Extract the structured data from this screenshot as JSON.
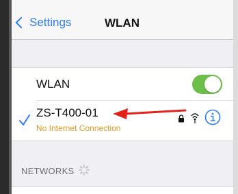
{
  "nav": {
    "back_label": "Settings",
    "title": "WLAN"
  },
  "wlan_row": {
    "label": "WLAN",
    "toggle_on": true
  },
  "connected_network": {
    "ssid": "ZS-T400-01",
    "status": "No Internet Connection",
    "icons": [
      "checkmark-icon",
      "lock-icon",
      "wifi-icon",
      "info-icon"
    ]
  },
  "networks_section": {
    "header": "NETWORKS"
  },
  "colors": {
    "accent": "#2e7cf6",
    "toggle_on": "#6cc04a",
    "warning": "#e59a1e",
    "annotation_arrow": "#e2231a"
  }
}
